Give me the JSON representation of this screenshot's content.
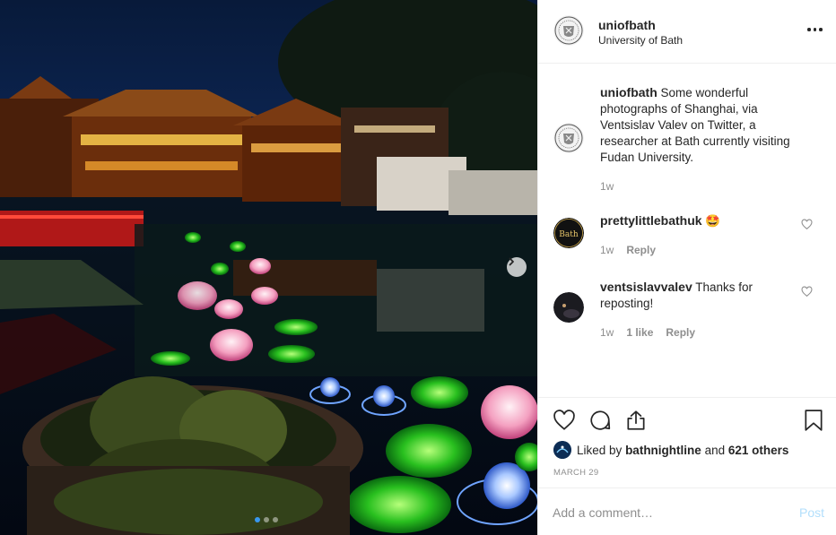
{
  "post": {
    "author": {
      "username": "uniofbath",
      "subtitle": "University of Bath"
    },
    "photo": {
      "description_icon": "night-lanterns-photo",
      "carousel": {
        "count": 3,
        "active": 1
      }
    },
    "caption": {
      "username": "uniofbath",
      "text": "Some wonderful photographs of Shanghai, via Ventsislav Valev on Twitter, a researcher at Bath currently visiting Fudan University.",
      "time": "1w"
    },
    "comments": [
      {
        "username": "prettylittlebathuk",
        "text": "🤩",
        "avatar_text": "Bath",
        "time": "1w",
        "likes": "",
        "reply": "Reply"
      },
      {
        "username": "ventsislavvalev",
        "text": "Thanks for reposting!",
        "time": "1w",
        "likes": "1 like",
        "reply": "Reply"
      }
    ],
    "liked_by": {
      "prefix": "Liked by",
      "user": "bathnightline",
      "connector": "and",
      "others": "621 others"
    },
    "date": "MARCH 29",
    "add_comment": {
      "placeholder": "Add a comment…",
      "post_label": "Post"
    }
  },
  "colors": {
    "accent": "#3897f0",
    "post_disabled": "#b2dffc",
    "muted": "#8e8e8e",
    "text": "#262626"
  }
}
